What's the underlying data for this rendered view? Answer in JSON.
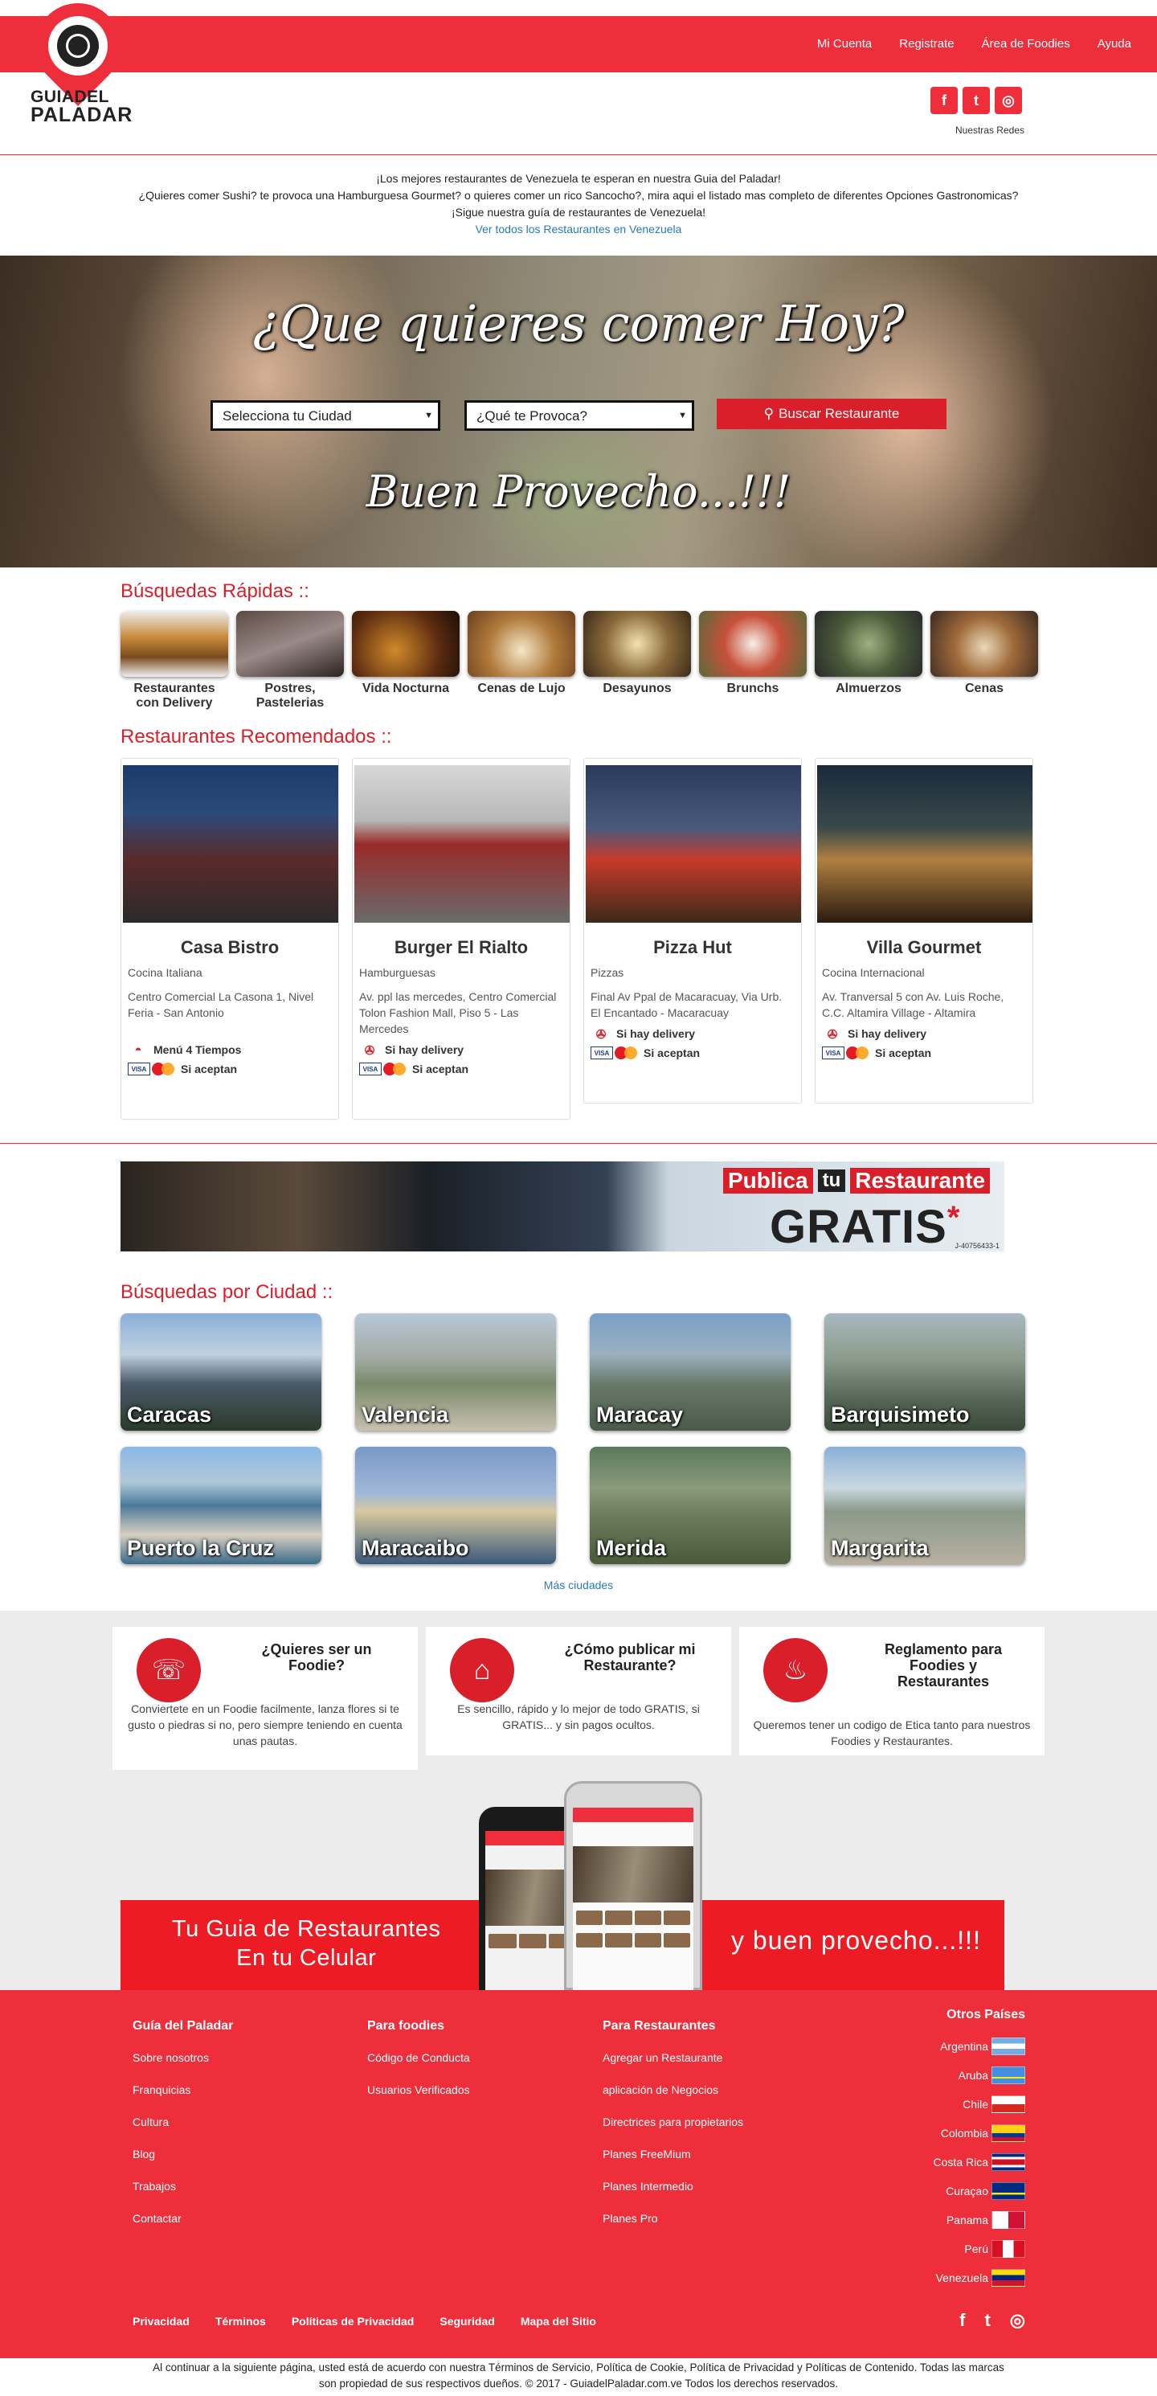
{
  "nav": {
    "items": [
      "Mi Cuenta",
      "Registrate",
      "Área de Foodies",
      "Ayuda"
    ]
  },
  "brand": {
    "line1": "GUIADEL",
    "line2": "PALADAR"
  },
  "social": {
    "caption": "Nuestras Redes",
    "icons": [
      "facebook-icon",
      "twitter-icon",
      "instagram-icon"
    ]
  },
  "intro": {
    "line1": "¡Los mejores restaurantes de Venezuela te esperan en nuestra Guia del Paladar!",
    "line2": "¿Quieres comer Sushi? te provoca una Hamburguesa Gourmet? o quieres comer un rico Sancocho?, mira aqui el listado mas completo de diferentes Opciones Gastronomicas?",
    "line3": "¡Sigue nuestra guía de restaurantes de Venezuela!",
    "link": "Ver todos los Restaurantes en Venezuela"
  },
  "hero": {
    "title": "¿Que quieres comer Hoy?",
    "city_select": "Selecciona tu Ciudad",
    "food_select": "¿Qué te Provoca?",
    "search_button": "Buscar Restaurante",
    "subtitle": "Buen Provecho...!!!"
  },
  "quick": {
    "title": "Búsquedas Rápidas ::",
    "items": [
      {
        "label": "Restaurantes con Delivery"
      },
      {
        "label": "Postres, Pastelerias"
      },
      {
        "label": "Vida Nocturna"
      },
      {
        "label": "Cenas de Lujo"
      },
      {
        "label": "Desayunos"
      },
      {
        "label": "Brunchs"
      },
      {
        "label": "Almuerzos"
      },
      {
        "label": "Cenas"
      }
    ]
  },
  "recommended": {
    "title": "Restaurantes Recomendados ::",
    "items": [
      {
        "name": "Casa Bistro",
        "type": "Cocina Italiana",
        "address": "Centro Comercial La Casona 1, Nivel Feria - San Antonio",
        "badge1": "Menú 4 Tiempos",
        "badge2": "Si aceptan"
      },
      {
        "name": "Burger El Rialto",
        "type": "Hamburguesas",
        "address": "Av. ppl las mercedes, Centro Comercial Tolon Fashion Mall, Piso 5 - Las Mercedes",
        "badge1": "Si hay delivery",
        "badge2": "Si aceptan"
      },
      {
        "name": "Pizza Hut",
        "type": "Pizzas",
        "address": "Final Av Ppal de Macaracuay, Via Urb. El Encantado - Macaracuay",
        "badge1": "Si hay delivery",
        "badge2": "Si aceptan"
      },
      {
        "name": "Villa Gourmet",
        "type": "Cocina Internacional",
        "address": "Av. Tranversal 5 con Av. Luis Roche, C.C. Altamira Village - Altamira",
        "badge1": "Si hay delivery",
        "badge2": "Si aceptan"
      }
    ]
  },
  "banner": {
    "publica": "Publica",
    "tu": "tu",
    "restaurante": "Restaurante",
    "gratis": "GRATIS",
    "asterisk": "*",
    "rif": "J-40756433-1"
  },
  "cities": {
    "title": "Búsquedas por Ciudad ::",
    "items": [
      "Caracas",
      "Valencia",
      "Maracay",
      "Barquisimeto",
      "Puerto la Cruz",
      "Maracaibo",
      "Merida",
      "Margarita"
    ],
    "more": "Más ciudades"
  },
  "info": [
    {
      "title": "¿Quieres ser un Foodie?",
      "text": "Conviertete en un Foodie facilmente, lanza flores si te gusto o piedras si no, pero siempre teniendo en cuenta unas pautas."
    },
    {
      "title": "¿Cómo publicar mi Restaurante?",
      "text": "Es sencillo, rápido y lo mejor de todo GRATIS, si GRATIS... y sin pagos ocultos."
    },
    {
      "title": "Reglamento para Foodies y Restaurantes",
      "text": "Queremos tener un codigo de Etica tanto para nuestros Foodies y Restaurantes."
    }
  ],
  "promo": {
    "left_line1": "Tu Guia de Restaurantes",
    "left_line2": "En tu Celular",
    "right": "y buen provecho...!!!"
  },
  "footer": {
    "col1": {
      "title": "Guía del Paladar",
      "links": [
        "Sobre nosotros",
        "Franquicias",
        "Cultura",
        "Blog",
        "Trabajos",
        "Contactar"
      ]
    },
    "col2": {
      "title": "Para foodies",
      "links": [
        "Código de Conducta",
        "Usuarios Verificados"
      ]
    },
    "col3": {
      "title": "Para Restaurantes",
      "links": [
        "Agregar un Restaurante",
        "aplicación de Negocios",
        "Directrices para propietarios",
        "Planes FreeMium",
        "Planes Intermedio",
        "Planes Pro"
      ]
    },
    "countries_title": "Otros Países",
    "countries": [
      "Argentina",
      "Aruba",
      "Chile",
      "Colombia",
      "Costa Rica",
      "Curaçao",
      "Panama",
      "Perú",
      "Venezuela"
    ],
    "bottom_links": [
      "Privacidad",
      "Términos",
      "Políticas de Privacidad",
      "Seguridad",
      "Mapa del Sitio"
    ]
  },
  "legal": {
    "line1": "Al continuar a la siguiente página, usted está de acuerdo con nuestra Términos de Servicio, Política de Cookie, Política de Privacidad y Políticas de Contenido. Todas las marcas",
    "line2": "son propiedad de sus respectivos dueños. © 2017 - GuiadelPaladar.com.ve Todos los derechos reservados."
  }
}
